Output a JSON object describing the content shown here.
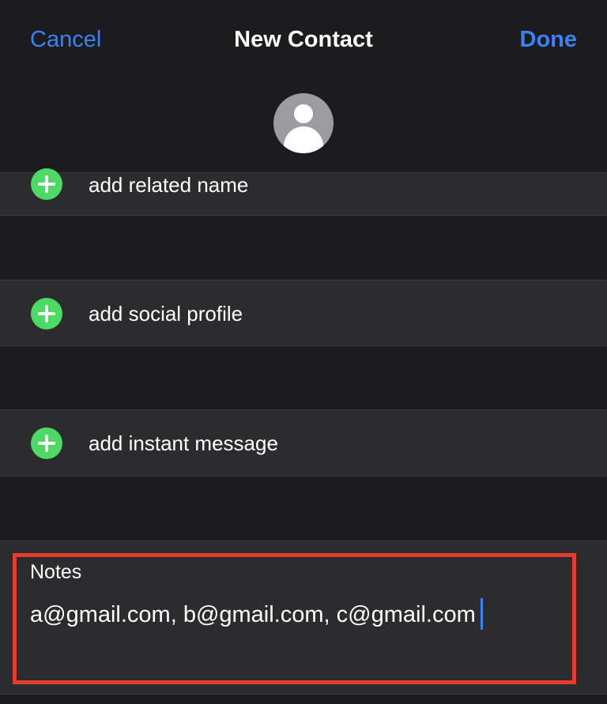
{
  "nav": {
    "cancel_label": "Cancel",
    "title": "New Contact",
    "done_label": "Done"
  },
  "avatar": {
    "icon": "person-placeholder-icon"
  },
  "fields": [
    {
      "label": "add related name",
      "icon": "plus-circle-icon"
    },
    {
      "label": "add social profile",
      "icon": "plus-circle-icon"
    },
    {
      "label": "add instant message",
      "icon": "plus-circle-icon"
    }
  ],
  "notes": {
    "label": "Notes",
    "value": "a@gmail.com, b@gmail.com, c@gmail.com"
  },
  "colors": {
    "accent": "#3a82f7",
    "add_icon": "#4cd964",
    "highlight_border": "#e53c2f",
    "background": "#1c1c1e",
    "row_background": "#2c2c2e"
  }
}
